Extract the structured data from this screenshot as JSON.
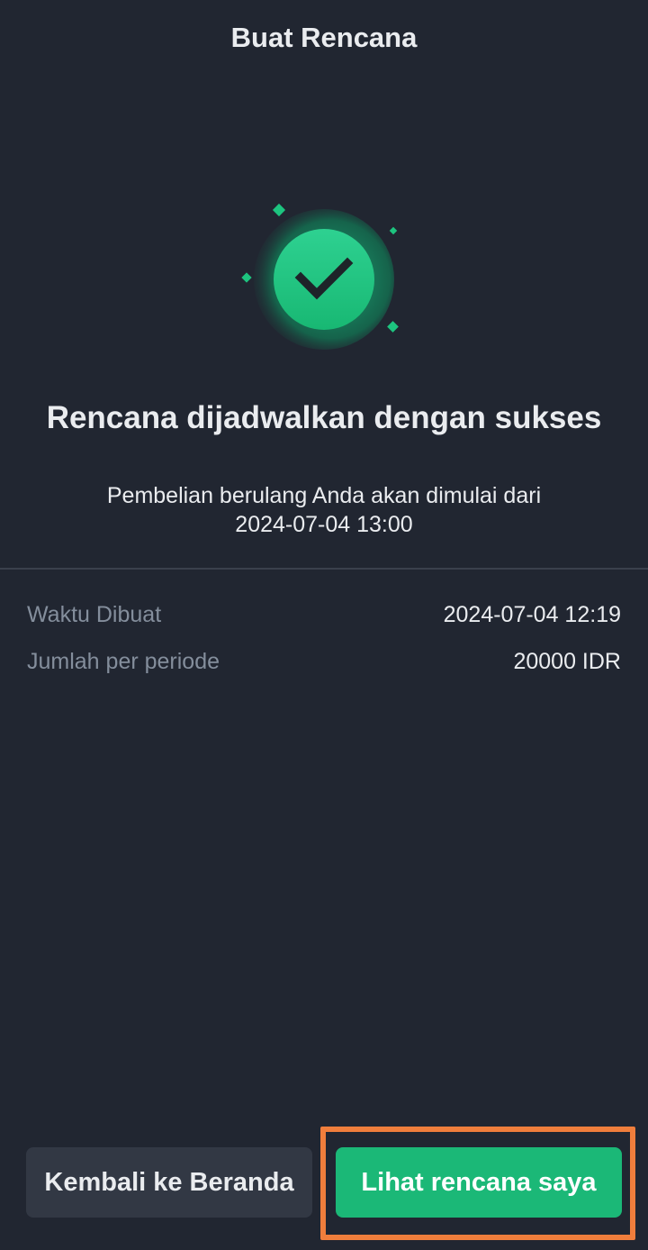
{
  "header": {
    "title": "Buat Rencana"
  },
  "success": {
    "icon": "check-circle-icon",
    "title": "Rencana dijadwalkan dengan sukses",
    "description_line1": "Pembelian berulang Anda akan dimulai dari",
    "description_line2": "2024-07-04 13:00"
  },
  "details": [
    {
      "label": "Waktu Dibuat",
      "value": "2024-07-04 12:19"
    },
    {
      "label": "Jumlah per periode",
      "value": "20000 IDR"
    }
  ],
  "actions": {
    "home_label": "Kembali ke Beranda",
    "view_plan_label": "Lihat rencana saya"
  },
  "colors": {
    "background": "#212631",
    "accent": "#1BB877",
    "secondary_button": "#323844",
    "highlight": "#F07E3C"
  }
}
